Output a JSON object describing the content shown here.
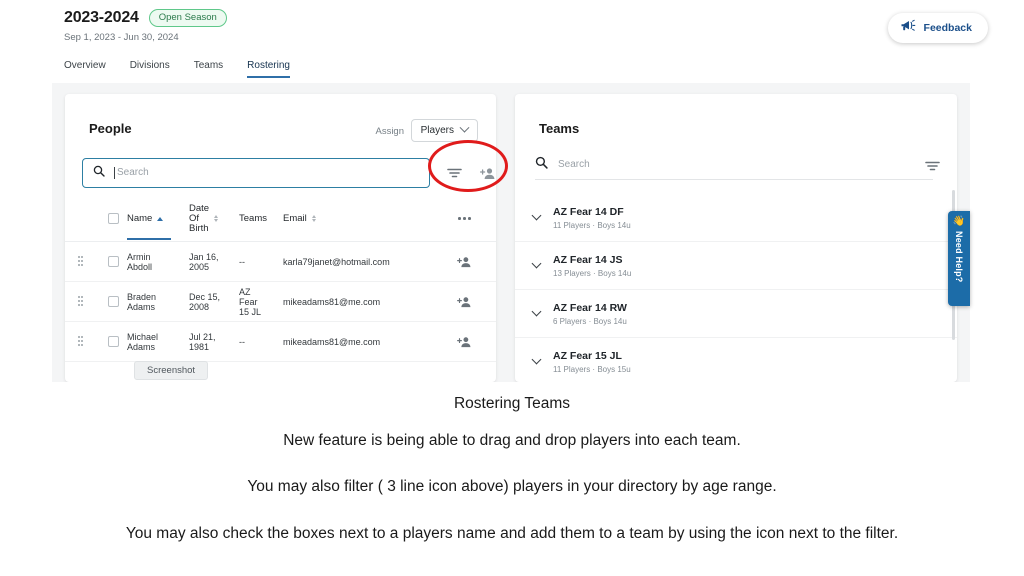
{
  "app": {
    "season_title": "2023-2024",
    "season_badge": "Open Season",
    "season_dates": "Sep 1, 2023 - Jun 30, 2024",
    "feedback_label": "Feedback",
    "nav": [
      {
        "label": "Overview",
        "active": false
      },
      {
        "label": "Divisions",
        "active": false
      },
      {
        "label": "Teams",
        "active": false
      },
      {
        "label": "Rostering",
        "active": true
      }
    ]
  },
  "people": {
    "title": "People",
    "assign_label": "Assign",
    "assign_value": "Players",
    "search_placeholder": "Search",
    "search_value": "",
    "columns": {
      "name": "Name",
      "dob_l1": "Date",
      "dob_l2": "Of",
      "dob_l3": "Birth",
      "teams": "Teams",
      "email": "Email"
    },
    "rows": [
      {
        "name_first": "Armin",
        "name_last": "Abdoll",
        "dob_l1": "Jan 16,",
        "dob_l2": "2005",
        "teams": "--",
        "teams_l2": "",
        "teams_l3": "",
        "email": "karla79janet@hotmail.com"
      },
      {
        "name_first": "Braden",
        "name_last": "Adams",
        "dob_l1": "Dec 15,",
        "dob_l2": "2008",
        "teams": "AZ",
        "teams_l2": "Fear",
        "teams_l3": "15 JL",
        "email": "mikeadams81@me.com"
      },
      {
        "name_first": "Michael",
        "name_last": "Adams",
        "dob_l1": "Jul 21,",
        "dob_l2": "1981",
        "teams": "--",
        "teams_l2": "",
        "teams_l3": "",
        "email": "mikeadams81@me.com"
      }
    ],
    "screenshot_pill": "Screenshot"
  },
  "teams": {
    "title": "Teams",
    "search_placeholder": "Search",
    "search_value": "",
    "list": [
      {
        "name": "AZ Fear 14 DF",
        "meta": "11 Players  ·  Boys 14u"
      },
      {
        "name": "AZ Fear 14 JS",
        "meta": "13 Players  ·  Boys 14u"
      },
      {
        "name": "AZ Fear 14 RW",
        "meta": "6 Players  ·  Boys 14u"
      },
      {
        "name": "AZ Fear 15 JL",
        "meta": "11 Players  ·  Boys 15u"
      }
    ]
  },
  "need_help": {
    "label": "Need Help?",
    "hand": "👋"
  },
  "caption": {
    "line0": "Rostering Teams",
    "line1": "New feature is being able to drag and drop players into each team.",
    "line2": "You may also filter ( 3 line icon above) players in your directory by age range.",
    "line3": "You may also check the boxes next to a players name and add them to a team by using the icon next to the filter."
  },
  "colors": {
    "accent_blue": "#2f6fa8",
    "brand_dark_blue": "#1b4f8a",
    "badge_green": "#2b7a4b",
    "annotation_red": "#e01b1b",
    "need_help_blue": "#1c6ca8"
  }
}
